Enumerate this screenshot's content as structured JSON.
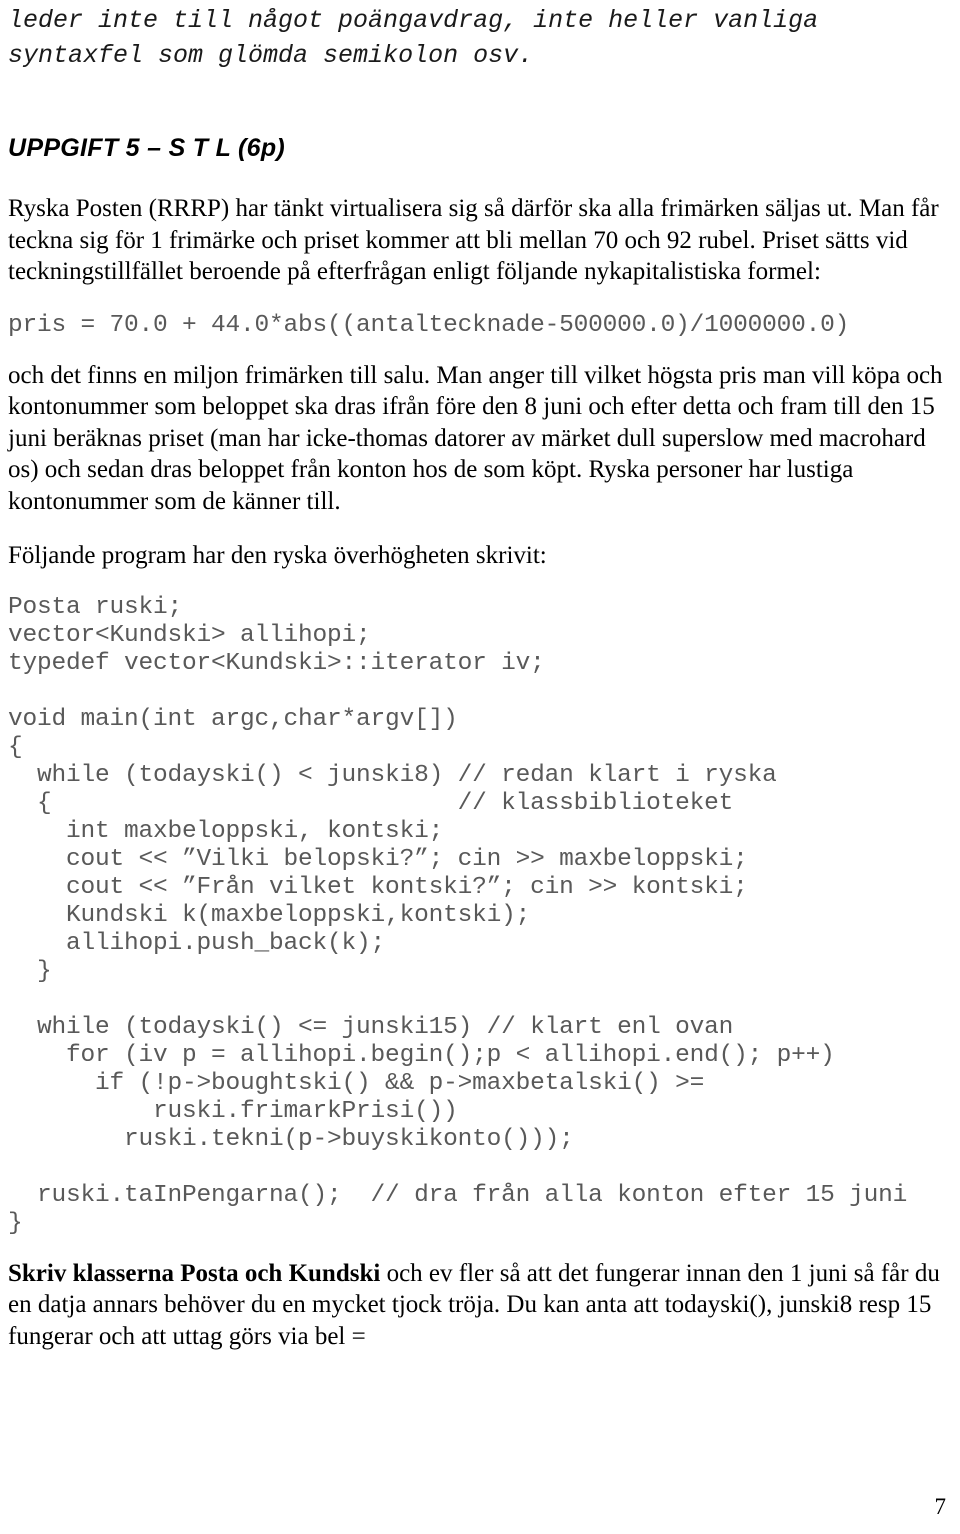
{
  "document": {
    "intro_lines": "leder inte till något poängavdrag, inte heller vanliga\nsyntaxfel som glömda semikolon osv.",
    "heading": "UPPGIFT 5 – S T L (6p)",
    "paragraph_1": "Ryska Posten (RRRP) har tänkt virtualisera sig så därför ska alla frimärken säljas ut. Man får teckna sig för 1 frimärke och priset kommer att bli mellan 70 och 92 rubel. Priset sätts vid teckningstillfället beroende på efterfrågan enligt följande nykapitalistiska formel:",
    "formula": "pris = 70.0 + 44.0*abs((antaltecknade-500000.0)/1000000.0)",
    "paragraph_2": "och det finns en miljon frimärken till salu. Man anger till vilket högsta pris man vill köpa och kontonummer som beloppet ska dras ifrån före den 8 juni och efter detta och fram till den 15 juni beräknas priset (man har icke-thomas datorer av märket dull superslow med macrohard os) och sedan dras beloppet från konton hos de som köpt. Ryska personer har lustiga kontonummer som de känner till.",
    "paragraph_3": "Följande program har den ryska överhögheten skrivit:",
    "code_block_1": "Posta ruski;\nvector<Kundski> allihopi;\ntypedef vector<Kundski>::iterator iv;\n\nvoid main(int argc,char*argv[])\n{\n  while (todayski() < junski8) // redan klart i ryska\n  {                            // klassbiblioteket\n    int maxbeloppski, kontski;\n    cout << ”Vilki belopski?”; cin >> maxbeloppski;\n    cout << ”Från vilket kontski?”; cin >> kontski;\n    Kundski k(maxbeloppski,kontski);\n    allihopi.push_back(k);\n  }\n\n  while (todayski() <= junski15) // klart enl ovan\n    for (iv p = allihopi.begin();p < allihopi.end(); p++)\n      if (!p->boughtski() && p->maxbetalski() >=\n          ruski.frimarkPrisi())\n        ruski.tekni(p->buyskikonto()));\n\n  ruski.taInPengarna();  // dra från alla konton efter 15 juni\n}",
    "paragraph_4_bold": "Skriv klasserna Posta och Kundski",
    "paragraph_4_rest": " och ev fler så att det fungerar innan den 1 juni så får du en datja annars behöver du en mycket tjock tröja. Du kan anta att todayski(), junski8 resp 15 fungerar och att uttag görs via bel =",
    "page_number": "7"
  },
  "colors": {
    "body_text": "#000000",
    "code_text": "#595959",
    "background": "#ffffff"
  }
}
